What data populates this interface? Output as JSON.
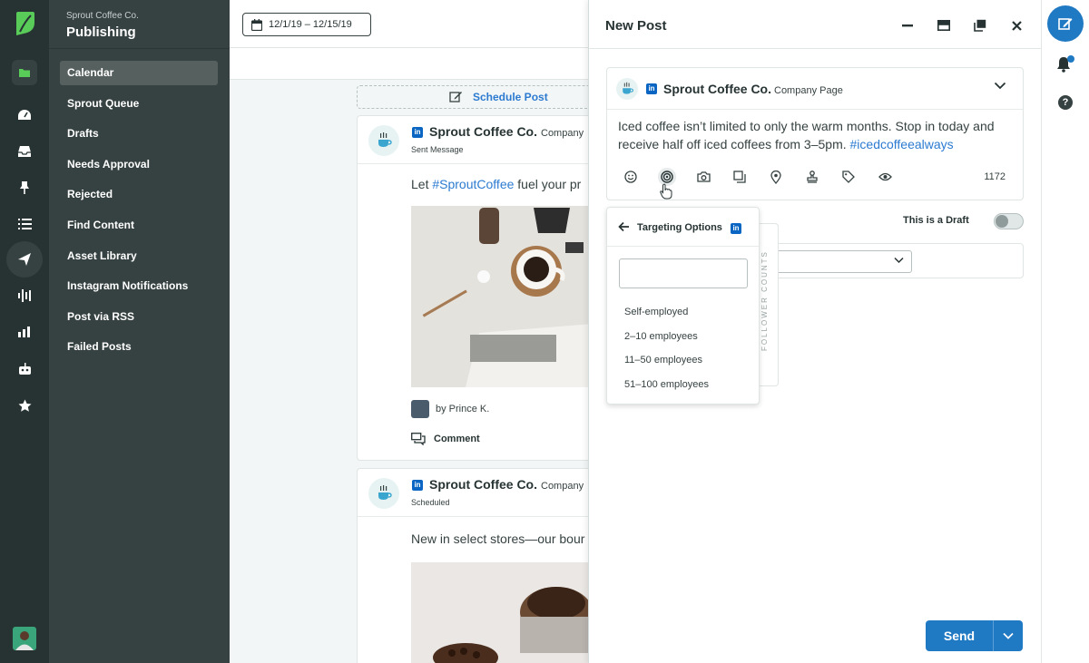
{
  "brand": {
    "org": "Sprout Coffee Co.",
    "section": "Publishing"
  },
  "nav": [
    "Calendar",
    "Sprout Queue",
    "Drafts",
    "Needs Approval",
    "Rejected",
    "Find Content",
    "Asset Library",
    "Instagram Notifications",
    "Post via RSS",
    "Failed Posts"
  ],
  "toolbar": {
    "date_range": "12/1/19 – 12/15/19",
    "schedule_label": "Schedule Post"
  },
  "feed": {
    "card1": {
      "name": "Sprout Coffee Co.",
      "page": "Company",
      "status": "Sent Message",
      "text_prefix": "Let ",
      "hashtag": "#SproutCoffee",
      "text_suffix": " fuel your pr",
      "byline": "by Prince K.",
      "comment": "Comment"
    },
    "card2": {
      "name": "Sprout Coffee Co.",
      "page": "Company",
      "status": "Scheduled",
      "text": "New in select stores—our bour"
    }
  },
  "compose": {
    "title": "New Post",
    "profile_name": "Sprout Coffee Co.",
    "profile_type": "Company Page",
    "message_text": "Iced coffee isn’t limited to only the warm months. Stop in today and receive half off iced coffees from 3–5pm. ",
    "message_hashtag": "#icedcoffeealways",
    "char_count": "1172",
    "draft_label": "This is a Draft",
    "send_label": "Send",
    "follower_counts": "FOLLOWER COUNTS",
    "targeting": {
      "title": "Targeting Options",
      "search_value": "",
      "options": [
        "Self-employed",
        "2–10 employees",
        "11–50 employees",
        "51–100 employees"
      ]
    }
  },
  "colors": {
    "accent": "#2079c3",
    "link": "#2c7bd1",
    "sidebar": "#364141",
    "rail": "#273333",
    "brand_green": "#59cb59"
  }
}
